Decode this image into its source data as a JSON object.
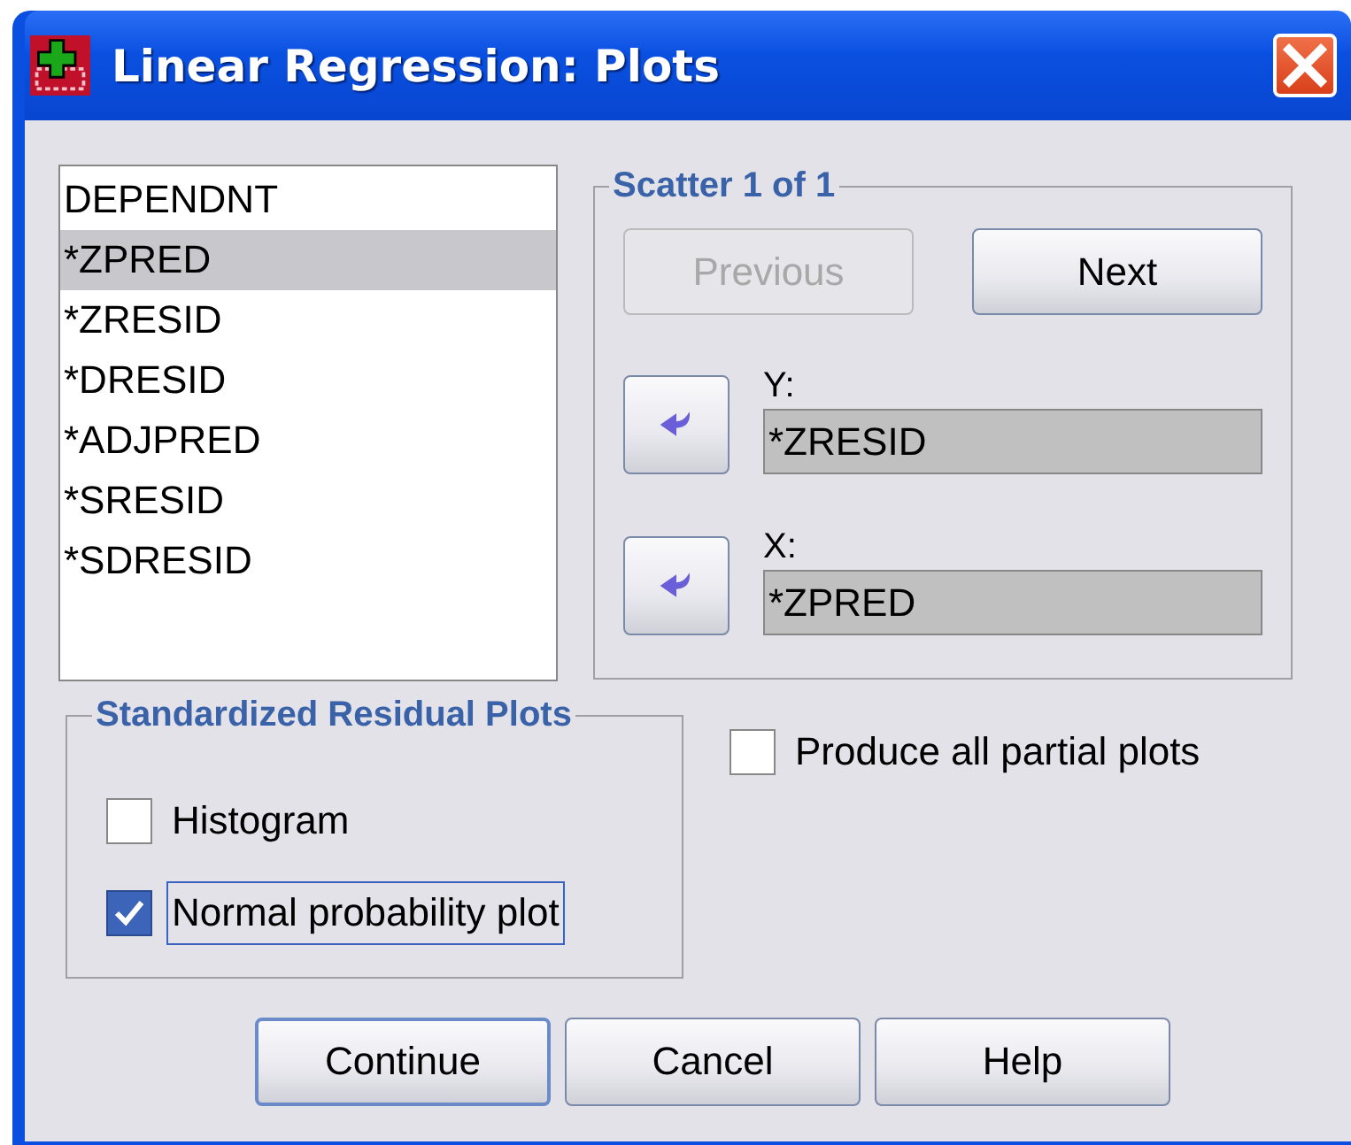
{
  "window": {
    "title": "Linear Regression: Plots"
  },
  "variables": [
    {
      "label": "DEPENDNT",
      "selected": false
    },
    {
      "label": "*ZPRED",
      "selected": true
    },
    {
      "label": "*ZRESID",
      "selected": false
    },
    {
      "label": "*DRESID",
      "selected": false
    },
    {
      "label": "*ADJPRED",
      "selected": false
    },
    {
      "label": "*SRESID",
      "selected": false
    },
    {
      "label": "*SDRESID",
      "selected": false
    }
  ],
  "scatter": {
    "title": "Scatter 1 of 1",
    "buttons": [
      {
        "label": "Previous",
        "disabled": true
      },
      {
        "label": "Next",
        "disabled": false
      }
    ],
    "fields": [
      {
        "label": "Y:",
        "value": "*ZRESID"
      },
      {
        "label": "X:",
        "value": "*ZPRED"
      }
    ]
  },
  "residual_plots": {
    "title": "Standardized Residual Plots",
    "options": [
      {
        "label": "Histogram",
        "checked": false,
        "focused": false
      },
      {
        "label": "Normal probability plot",
        "checked": true,
        "focused": true
      }
    ]
  },
  "partial_plots": {
    "label": "Produce all partial plots",
    "checked": false
  },
  "buttons": [
    {
      "label": "Continue",
      "default": true
    },
    {
      "label": "Cancel",
      "default": false
    },
    {
      "label": "Help",
      "default": false
    }
  ]
}
